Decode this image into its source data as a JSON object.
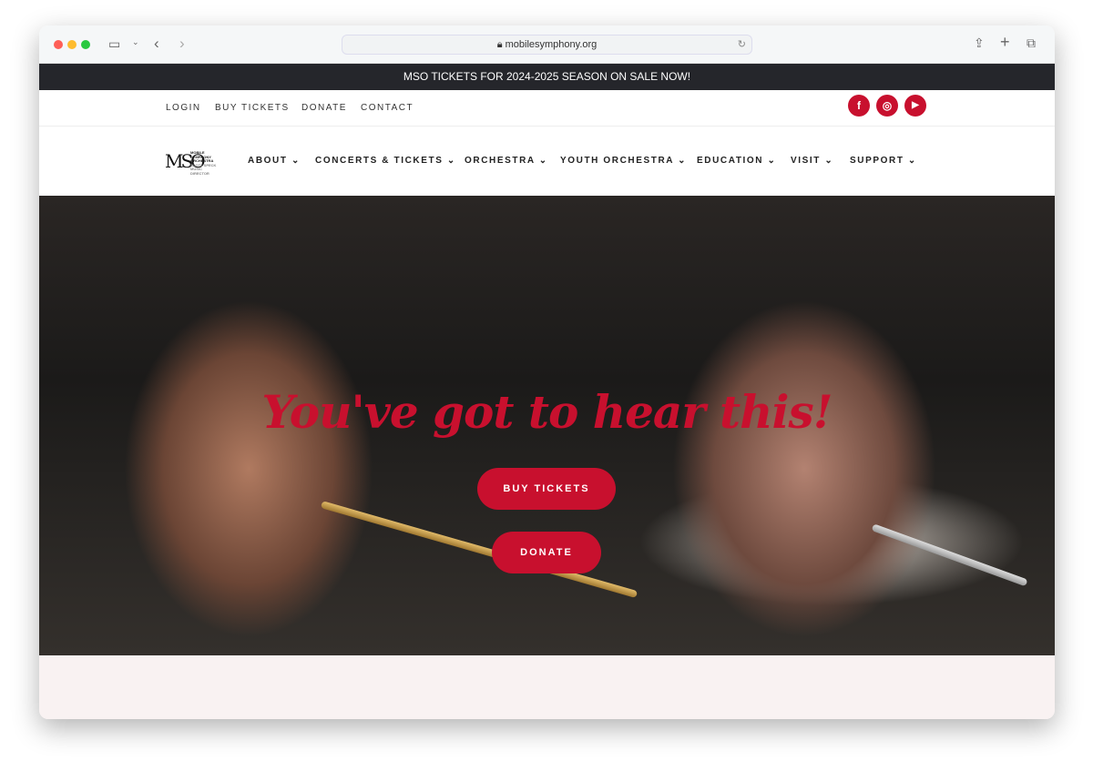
{
  "browser": {
    "url": "mobilesymphony.org"
  },
  "banner": {
    "text": "MSO TICKETS FOR 2024-2025 SEASON ON SALE NOW!"
  },
  "topnav": [
    "LOGIN",
    "BUY TICKETS",
    "DONATE",
    "CONTACT"
  ],
  "social": [
    {
      "icon": "facebook-icon",
      "glyph": "f"
    },
    {
      "icon": "instagram-icon",
      "glyph": "◎"
    },
    {
      "icon": "youtube-icon",
      "glyph": "▶"
    }
  ],
  "logo": {
    "mark": "MSO",
    "lines": [
      "MOBILE",
      "SYMPHONY",
      "ORCHESTRA",
      "SCOTT SPECK",
      "MUSIC DIRECTOR"
    ]
  },
  "mainnav": [
    "ABOUT",
    "CONCERTS & TICKETS",
    "ORCHESTRA",
    "YOUTH ORCHESTRA",
    "EDUCATION",
    "VISIT",
    "SUPPORT"
  ],
  "hero": {
    "slogan": "You've got to hear this!",
    "buy_label": "BUY TICKETS",
    "donate_label": "DONATE"
  },
  "colors": {
    "brand": "#c8102e",
    "banner": "#25262b"
  }
}
